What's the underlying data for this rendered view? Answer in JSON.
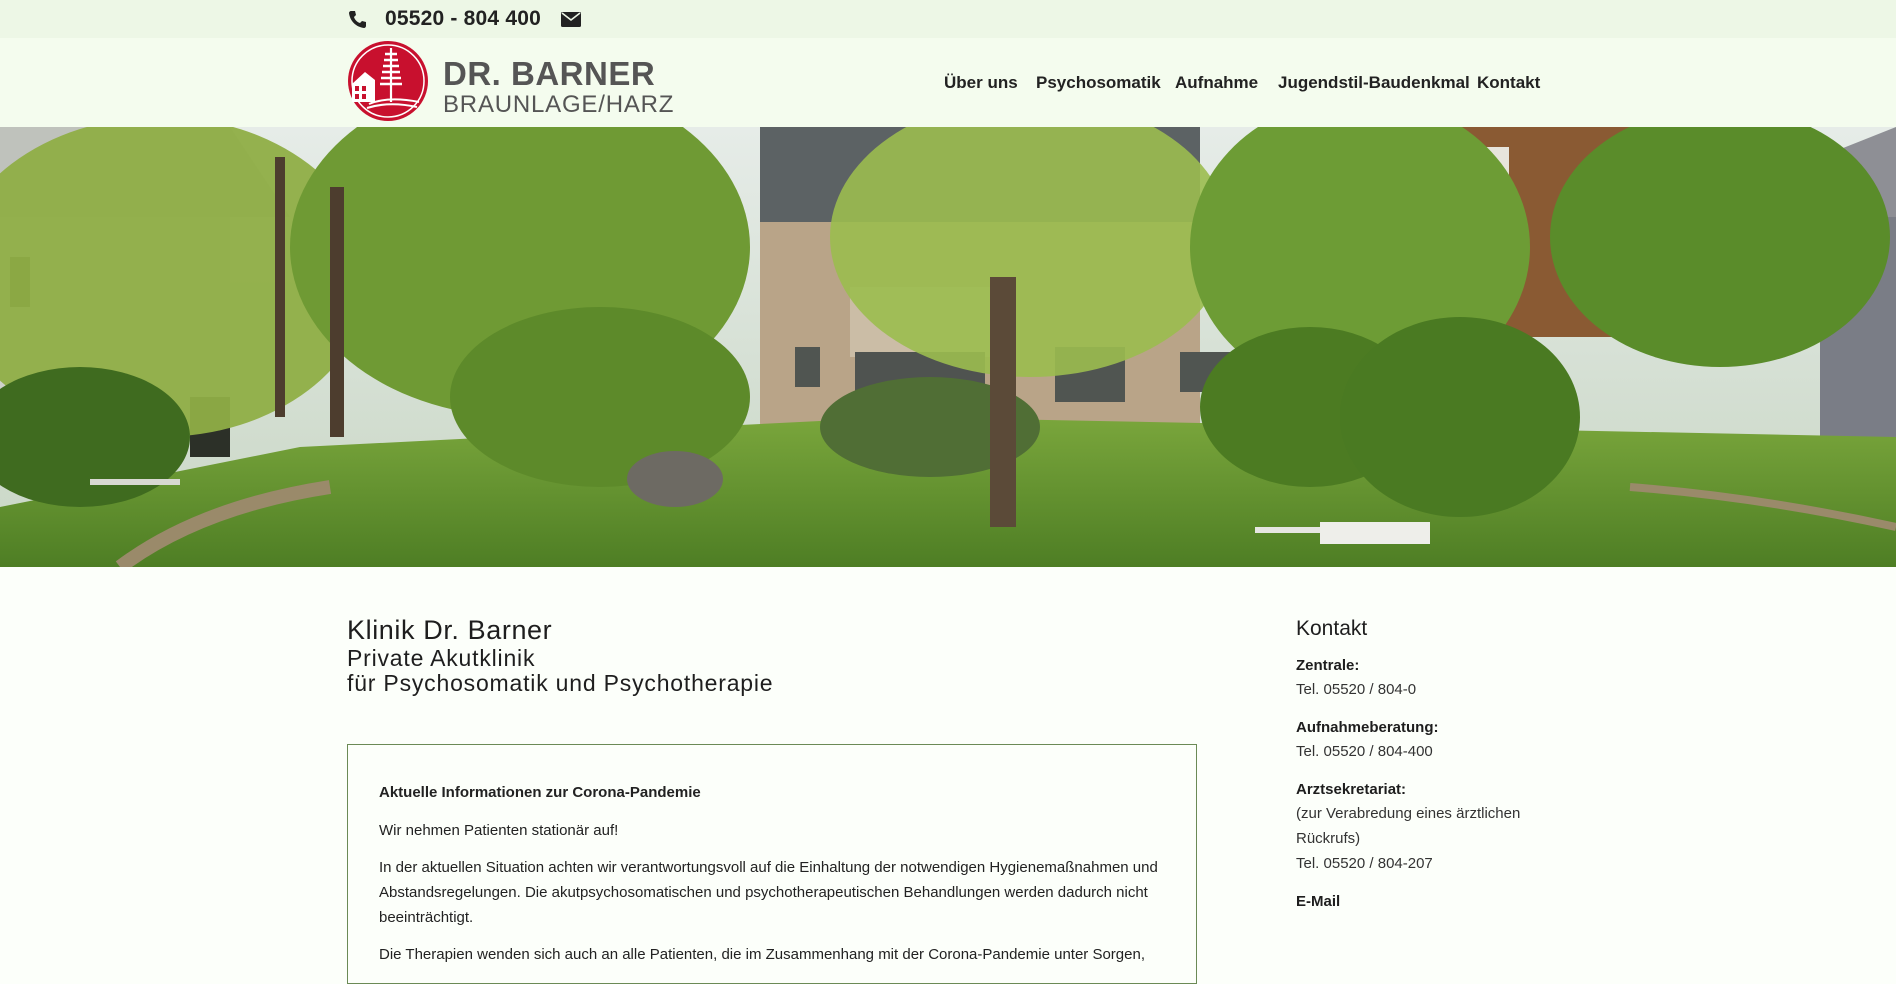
{
  "topbar": {
    "phone": "05520 - 804 400"
  },
  "brand": {
    "line1": "DR. BARNER",
    "line2": "BRAUNLAGE/HARZ"
  },
  "nav": [
    "Über uns",
    "Psychosomatik",
    "Aufnahme",
    "Jugendstil-Baudenkmal",
    "Kontakt"
  ],
  "main": {
    "title": "Klinik Dr. Barner",
    "subtitle1": "Private Akutklinik",
    "subtitle2": "für Psychosomatik und Psychotherapie",
    "notice": {
      "heading": "Aktuelle Informationen zur Corona-Pandemie",
      "p1": "Wir nehmen Patienten stationär auf!",
      "p2": "In der aktuellen Situation achten wir verantwortungsvoll auf die Einhaltung der notwendigen Hygienemaßnahmen und Abstandsregelungen. Die akutpsychosomatischen und psychotherapeutischen Behandlungen werden dadurch nicht beeinträchtigt.",
      "p3": "Die Therapien wenden sich auch an alle Patienten, die im Zusammenhang mit der Corona-Pandemie unter Sorgen,"
    }
  },
  "sidebar": {
    "heading": "Kontakt",
    "zentrale_label": "Zentrale:",
    "zentrale_tel": "Tel. 05520 / 804-0",
    "aufnahme_label": "Aufnahmeberatung:",
    "aufnahme_tel": "Tel. 05520 / 804-400",
    "arzt_label": "Arztsekretariat:",
    "arzt_note": "(zur Verabredung eines ärztlichen Rückrufs)",
    "arzt_tel": "Tel. 05520 / 804-207",
    "email_label": "E-Mail"
  },
  "colors": {
    "topbar": "#edf7e6",
    "header": "#f4fcee",
    "logo_red": "#c8102e",
    "box_border": "#6b8a55"
  }
}
